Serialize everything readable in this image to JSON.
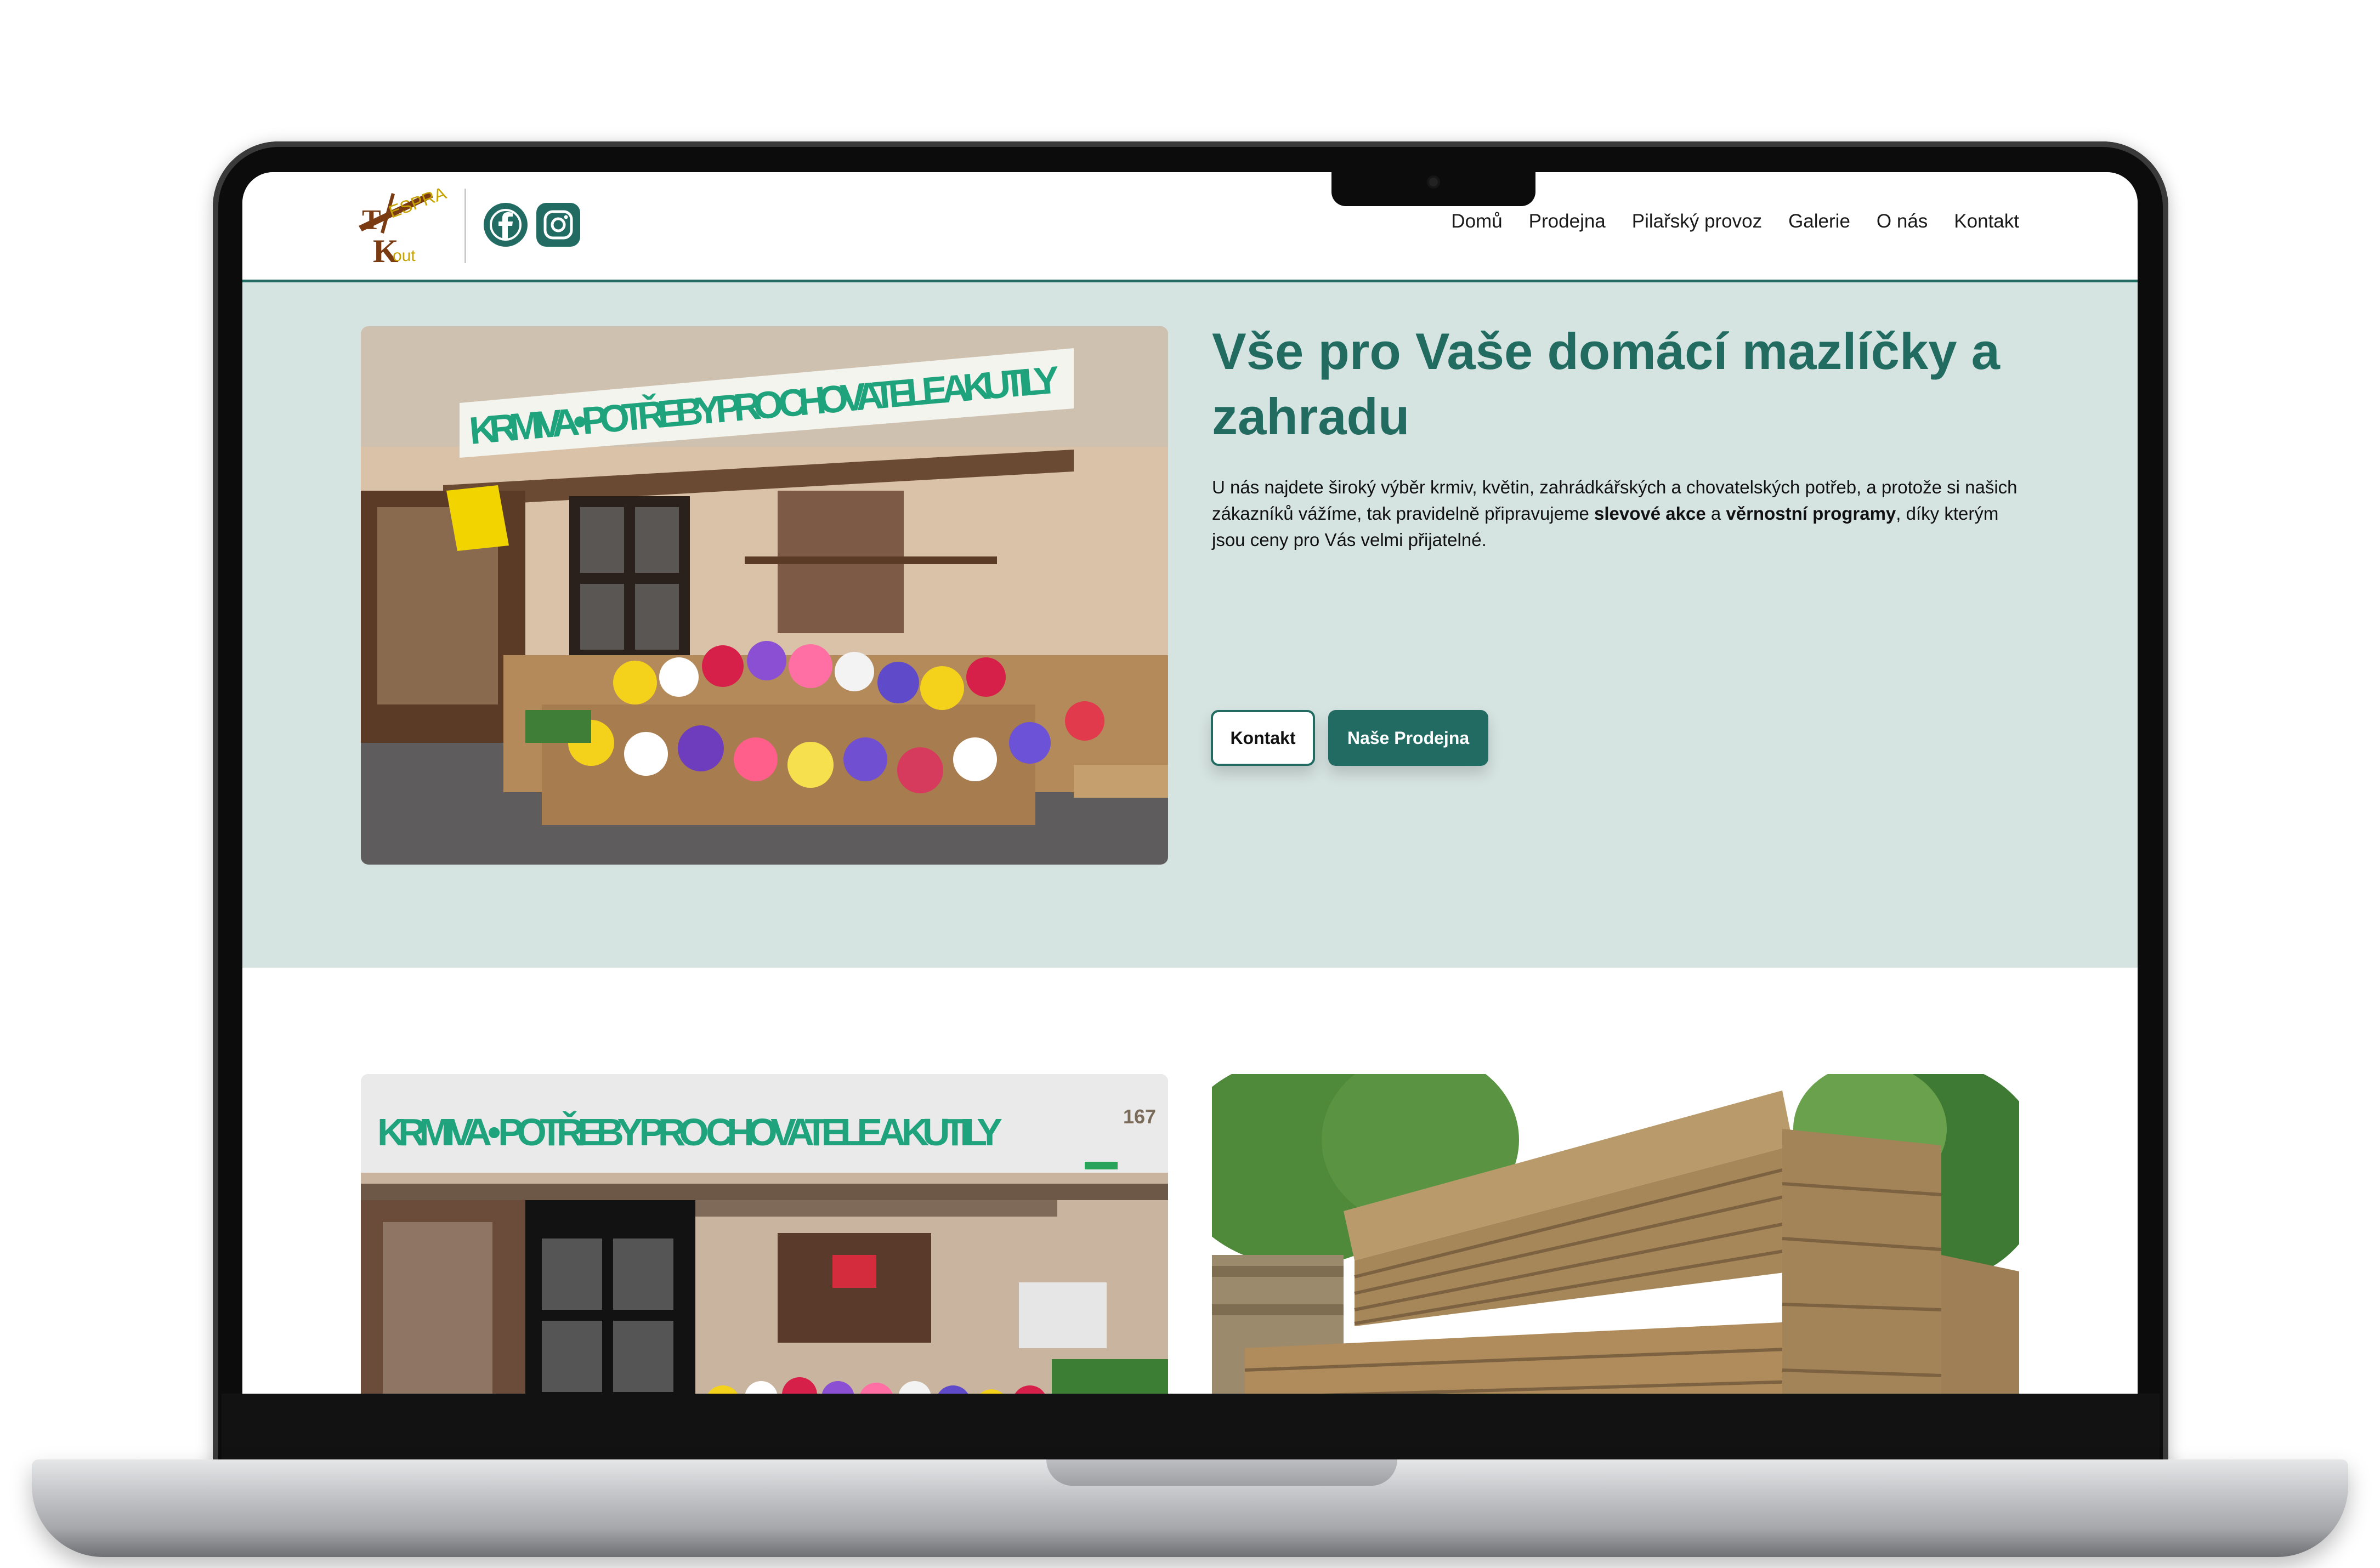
{
  "site": {
    "logo": {
      "text_top": "ESPRA",
      "text_bottom": "out",
      "letter_t": "T",
      "letter_k": "K"
    },
    "social": [
      {
        "name": "facebook",
        "icon": "facebook-icon"
      },
      {
        "name": "instagram",
        "icon": "instagram-icon"
      }
    ],
    "nav": [
      "Domů",
      "Prodejna",
      "Pilařský provoz",
      "Galerie",
      "O nás",
      "Kontakt"
    ]
  },
  "hero": {
    "title": "Vše pro Vaše domácí mazlíčky a zahradu",
    "text_part1": "U nás najdete široký výběr krmiv, květin, zahrádkářských a chovatelských potřeb, a protože si našich zákazníků vážíme, tak pravidelně připravujeme ",
    "text_bold1": "slevové akce",
    "text_part2": " a ",
    "text_bold2": "věrnostní programy",
    "text_part3": ", díky kterým jsou ceny pro Vás velmi přijatelné.",
    "buttons": {
      "contact": "Kontakt",
      "shop": "Naše Prodejna"
    },
    "photo_sign": "KRMIVA • POTŘEBY PRO CHOVATELE A KUTILY"
  },
  "cards": {
    "shop_sign": "KRMIVA • POTŘEBY PRO CHOVATELE A KUTILY",
    "house_number": "167"
  },
  "colors": {
    "brand": "#226b62",
    "hero_bg": "#d5e3e1",
    "sign_text": "#1fa37c"
  }
}
